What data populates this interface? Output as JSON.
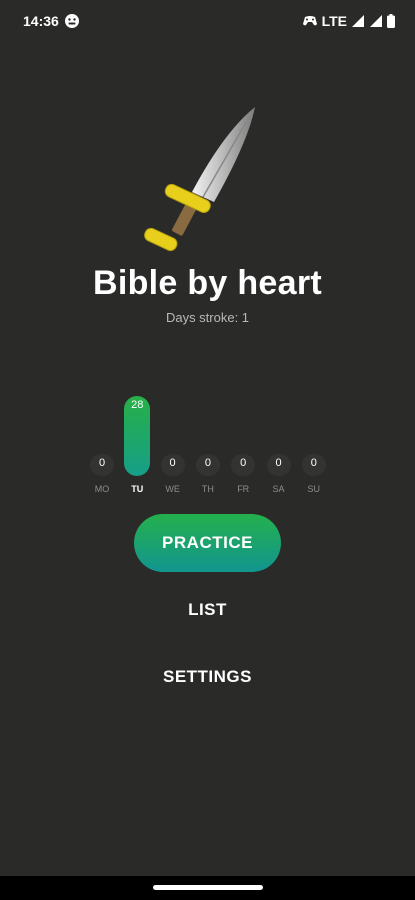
{
  "status_bar": {
    "time": "14:36",
    "network": "LTE",
    "icons": [
      "face-icon",
      "game-controller-icon",
      "signal-icon",
      "battery-icon"
    ]
  },
  "app": {
    "title": "Bible by heart",
    "subtitle": "Days stroke: 1",
    "logo": "dagger-icon"
  },
  "chart_data": {
    "type": "bar",
    "categories": [
      "MO",
      "TU",
      "WE",
      "TH",
      "FR",
      "SA",
      "SU"
    ],
    "values": [
      0,
      28,
      0,
      0,
      0,
      0,
      0
    ],
    "highlight": "TU",
    "colors": {
      "bar": "#27b047",
      "bar_end": "#169f88",
      "track": "#333432"
    }
  },
  "menu": {
    "practice_label": "PRACTICE",
    "list_label": "LIST",
    "settings_label": "SETTINGS"
  },
  "colors": {
    "background": "#2a2b29",
    "accent": "#24b04c",
    "accent_end": "#12958f"
  }
}
